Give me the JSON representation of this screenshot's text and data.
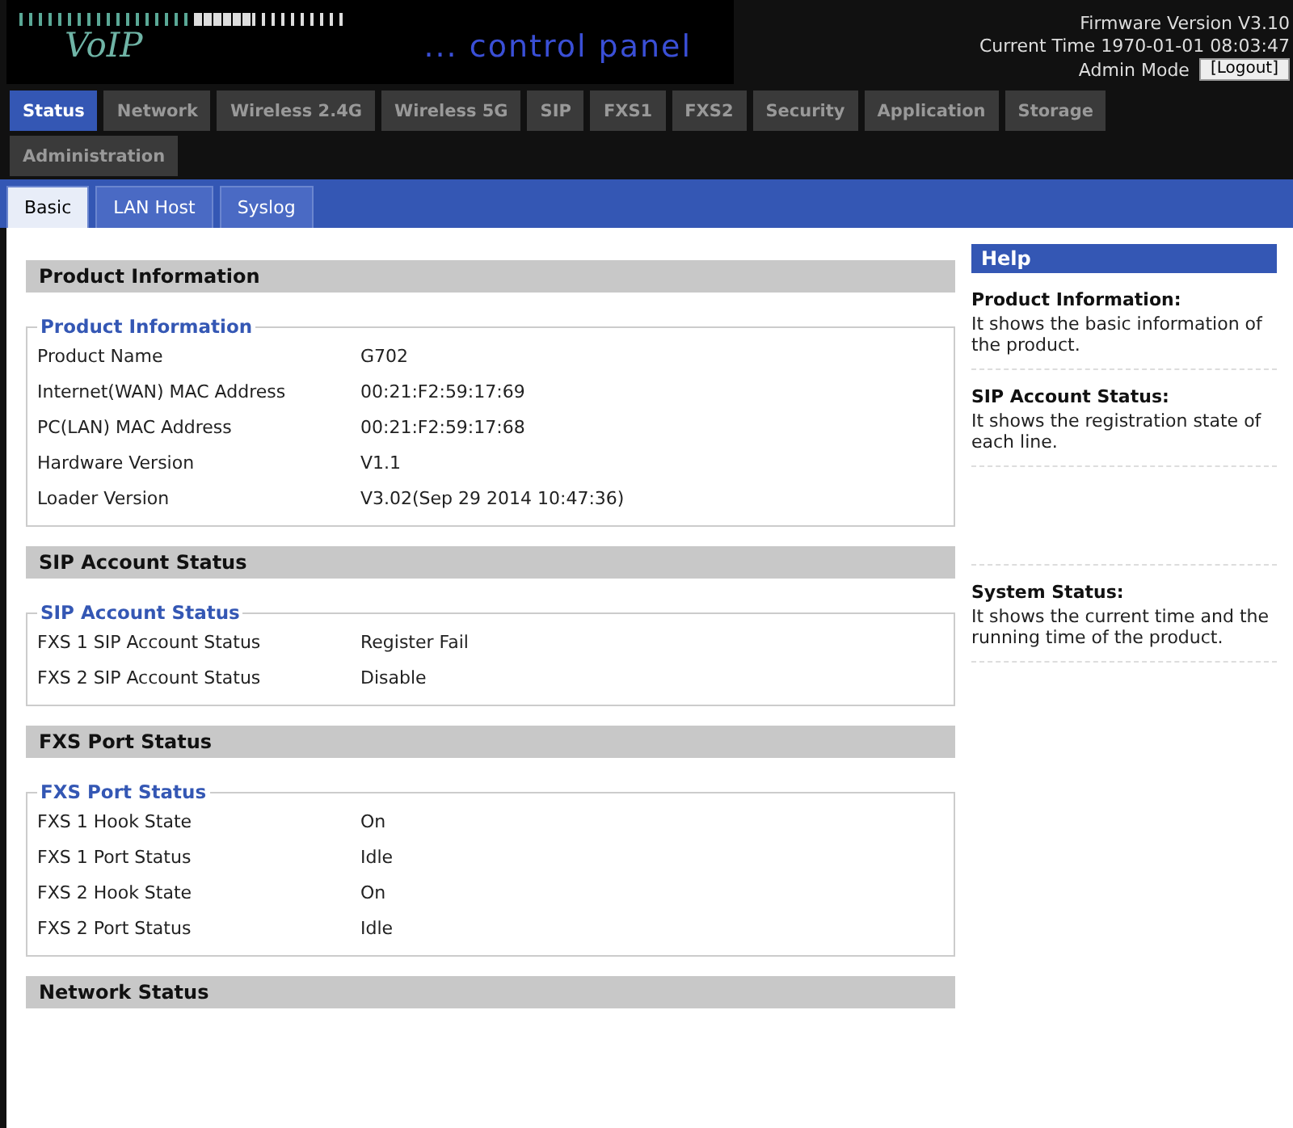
{
  "header": {
    "logo": "VoIP",
    "tagline": "... control panel",
    "firmware": "Firmware Version V3.10",
    "time": "Current Time 1970-01-01 08:03:47",
    "mode": "Admin Mode",
    "logout": "[Logout]"
  },
  "tabs": [
    {
      "label": "Status",
      "selected": true
    },
    {
      "label": "Network",
      "selected": false
    },
    {
      "label": "Wireless 2.4G",
      "selected": false
    },
    {
      "label": "Wireless 5G",
      "selected": false
    },
    {
      "label": "SIP",
      "selected": false
    },
    {
      "label": "FXS1",
      "selected": false
    },
    {
      "label": "FXS2",
      "selected": false
    },
    {
      "label": "Security",
      "selected": false
    },
    {
      "label": "Application",
      "selected": false
    },
    {
      "label": "Storage",
      "selected": false
    },
    {
      "label": "Administration",
      "selected": false
    }
  ],
  "subtabs": [
    {
      "label": "Basic",
      "selected": true
    },
    {
      "label": "LAN Host",
      "selected": false
    },
    {
      "label": "Syslog",
      "selected": false
    }
  ],
  "sections": [
    {
      "title": "Product Information",
      "legend": "Product Information",
      "rows": [
        {
          "label": "Product Name",
          "value": "G702"
        },
        {
          "label": "Internet(WAN) MAC Address",
          "value": "00:21:F2:59:17:69"
        },
        {
          "label": "PC(LAN) MAC Address",
          "value": "00:21:F2:59:17:68"
        },
        {
          "label": "Hardware Version",
          "value": "V1.1"
        },
        {
          "label": "Loader Version",
          "value": "V3.02(Sep 29 2014 10:47:36)"
        }
      ]
    },
    {
      "title": "SIP Account Status",
      "legend": "SIP Account Status",
      "rows": [
        {
          "label": "FXS 1 SIP Account Status",
          "value": "Register Fail"
        },
        {
          "label": "FXS 2 SIP Account Status",
          "value": "Disable"
        }
      ]
    },
    {
      "title": "FXS Port Status",
      "legend": "FXS Port Status",
      "rows": [
        {
          "label": "FXS 1 Hook State",
          "value": "On"
        },
        {
          "label": "FXS 1 Port Status",
          "value": "Idle"
        },
        {
          "label": "FXS 2 Hook State",
          "value": "On"
        },
        {
          "label": "FXS 2 Port Status",
          "value": "Idle"
        }
      ]
    },
    {
      "title": "Network Status"
    }
  ],
  "help": {
    "title": "Help",
    "items": [
      {
        "heading": "Product Information:",
        "text": "It shows the basic information of the product."
      },
      {
        "heading": "SIP Account Status:",
        "text": "It shows the registration state of each line."
      },
      {
        "kind": "blank"
      },
      {
        "heading": "System Status:",
        "text": "It shows the current time and the running time of the product."
      }
    ]
  }
}
